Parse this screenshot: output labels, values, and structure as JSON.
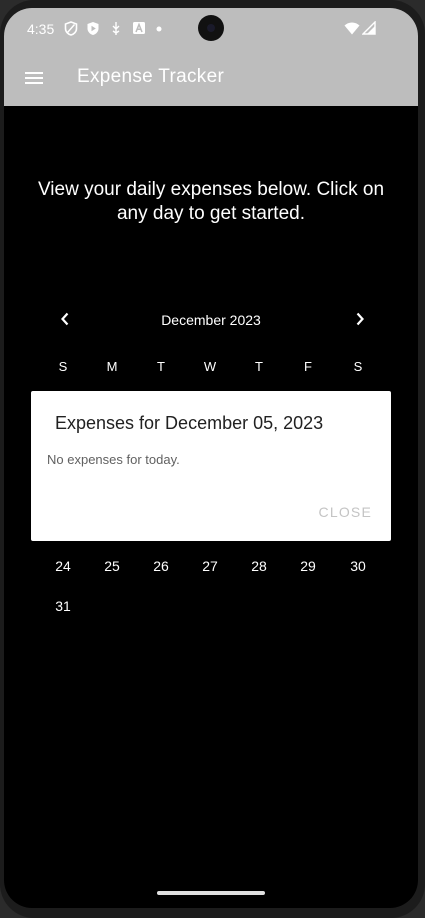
{
  "status_bar": {
    "time": "4:35",
    "left_icons": [
      "shield-icon",
      "play-shield-icon",
      "usb-debug-icon",
      "a-square-icon",
      "dot-icon"
    ],
    "right_icons": [
      "wifi-icon",
      "signal-icon"
    ]
  },
  "app_bar": {
    "title": "Expense Tracker",
    "menu_icon": "hamburger-menu-icon",
    "background": "#bdbdbd"
  },
  "intro_text": "View your daily expenses below. Click on any day to get started.",
  "calendar": {
    "month_label": "December 2023",
    "prev_icon": "chevron-left-icon",
    "next_icon": "chevron-right-icon",
    "weekdays": [
      "S",
      "M",
      "T",
      "W",
      "T",
      "F",
      "S"
    ],
    "visible_weeks": [
      [
        "24",
        "25",
        "26",
        "27",
        "28",
        "29",
        "30"
      ],
      [
        "31"
      ]
    ]
  },
  "dialog": {
    "title": "Expenses for December 05, 2023",
    "message": "No expenses for today.",
    "close_label": "CLOSE"
  }
}
